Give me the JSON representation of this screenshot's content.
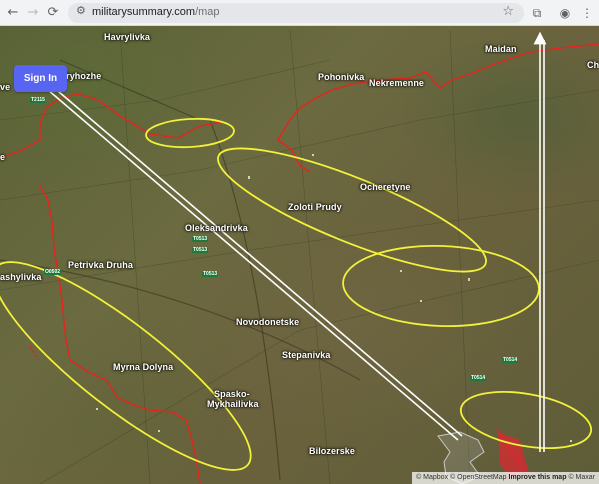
{
  "browser": {
    "back_icon": "←",
    "forward_icon": "→",
    "reload_icon": "⟳",
    "tune_icon": "⚙",
    "url_domain": "militarysummary.com",
    "url_path": "/map",
    "bookmark_icon": "☆",
    "extensions_icon": "⧉",
    "profile_icon": "◉",
    "menu_icon": "⋮"
  },
  "signin": {
    "label": "Sign In"
  },
  "places": [
    {
      "name": "Havrylivka"
    },
    {
      "name": "Maidan"
    },
    {
      "name": "Ch"
    },
    {
      "name": "ve"
    },
    {
      "name": "Pryhozhe"
    },
    {
      "name": "Pohonivka"
    },
    {
      "name": "Nekremenne"
    },
    {
      "name": "e"
    },
    {
      "name": "Ocheretyne"
    },
    {
      "name": "Zoloti Prudy"
    },
    {
      "name": "Oleksandrivka"
    },
    {
      "name": "ashylivka"
    },
    {
      "name": "Petrivka Druha"
    },
    {
      "name": "Novodonetske"
    },
    {
      "name": "Stepanivka"
    },
    {
      "name": "Myrna Dolyna"
    },
    {
      "name": "Spasko-"
    },
    {
      "name": "Mykhailivka"
    },
    {
      "name": "Bilozerske"
    }
  ],
  "road_labels": [
    {
      "code": "T2115"
    },
    {
      "code": "T0513"
    },
    {
      "code": "T0513"
    },
    {
      "code": "T0513"
    },
    {
      "code": "O0502"
    },
    {
      "code": "T0514"
    },
    {
      "code": "T0514"
    }
  ],
  "attribution": {
    "mapbox": "© Mapbox",
    "osm": "© OpenStreetMap",
    "improve": "Improve this map",
    "maxar": "© Maxar"
  },
  "colors": {
    "frontline": "#e8231e",
    "ellipse": "#f2f23a",
    "arrow": "#ffffff",
    "signin_bg": "#5865f2",
    "road_badge": "#1d7a3a"
  }
}
